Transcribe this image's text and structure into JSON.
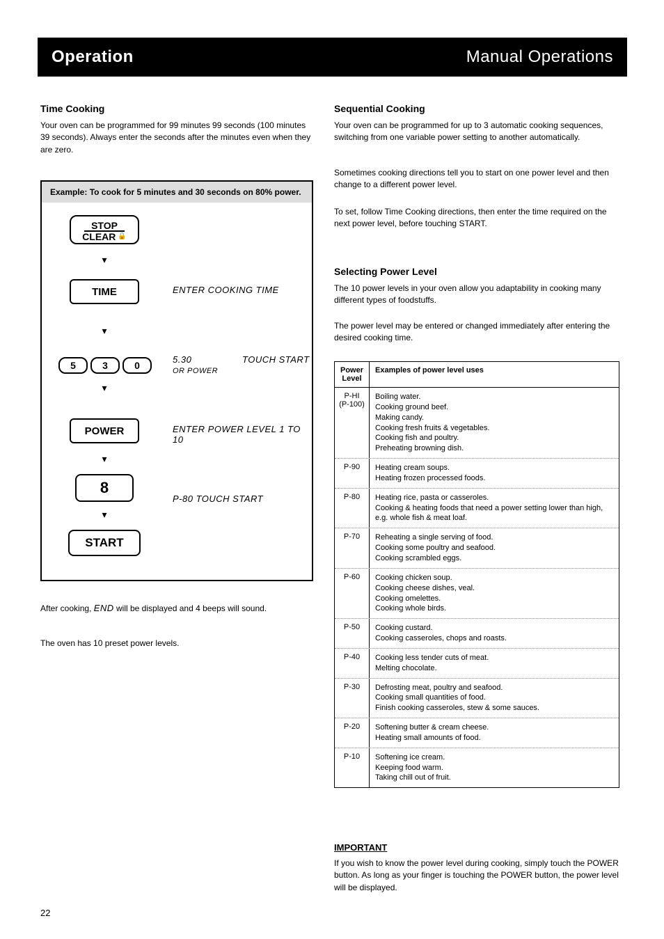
{
  "header": {
    "left": "Operation",
    "right": "Manual Operations"
  },
  "section": {
    "title": "Time Cooking",
    "intro": "Your oven can be programmed for 99 minutes 99 seconds (100 minutes 39 seconds). Always enter the seconds after the minutes even when they are zero."
  },
  "example": {
    "header": "Example: To cook for 5 minutes and 30 seconds on 80% power.",
    "buttons": {
      "stop": "STOP",
      "clear": "CLEAR",
      "time": "TIME",
      "d5": "5",
      "d3": "3",
      "d0": "0",
      "power": "POWER",
      "eight": "8",
      "start": "START"
    },
    "displays": {
      "enter_time": "ENTER COOKING TIME",
      "touch_start": "TOUCH START",
      "or_power": "OR POWER",
      "five30": "5.30",
      "enter_power": "ENTER POWER LEVEL 1 TO 10",
      "p80": "P-80 TOUCH START"
    }
  },
  "after": {
    "p1_a": "After cooking, ",
    "p1_b": "END",
    "p1_c": " will be displayed and 4 beeps will sound.",
    "p2": "The oven has 10 preset power levels."
  },
  "right": {
    "sequential": {
      "title": "Sequential Cooking",
      "body_a": "Your oven can be programmed for up to 3 automatic cooking sequences, switching from one variable power setting to another automatically.",
      "body_b": "Sometimes cooking directions tell you to start on one power level and then change to a different power level.",
      "body_c": "To set, follow Time Cooking directions, then enter the time required on the next power level, before touching START."
    },
    "selecting": {
      "title": "Selecting Power Level",
      "body_a": "The 10 power levels in your oven allow you adaptability in cooking many different types of foodstuffs.",
      "body_b": "The power level may be entered or changed immediately after entering the desired cooking time."
    },
    "table_header": {
      "a": "Power\nLevel",
      "b": "Examples of power level uses"
    },
    "table": [
      {
        "lvl": "P-HI\n(P-100)",
        "use": "Boiling water.\nCooking ground beef.\nMaking candy.\nCooking fresh fruits & vegetables.\nCooking fish and poultry.\nPreheating browning dish."
      },
      {
        "lvl": "P-90",
        "use": "Heating cream soups.\nHeating frozen processed foods."
      },
      {
        "lvl": "P-80",
        "use": "Heating rice, pasta or casseroles.\nCooking & heating foods that need a power setting lower than high, e.g. whole fish & meat loaf."
      },
      {
        "lvl": "P-70",
        "use": "Reheating a single serving of food.\nCooking some poultry and seafood.\nCooking scrambled eggs."
      },
      {
        "lvl": "P-60",
        "use": "Cooking chicken soup.\nCooking cheese dishes, veal.\nCooking omelettes.\nCooking whole birds."
      },
      {
        "lvl": "P-50",
        "use": "Cooking custard.\nCooking casseroles, chops and roasts."
      },
      {
        "lvl": "P-40",
        "use": "Cooking less tender cuts of meat.\nMelting chocolate."
      },
      {
        "lvl": "P-30",
        "use": "Defrosting meat, poultry and seafood.\nCooking small quantities of food.\nFinish cooking casseroles, stew & some sauces."
      },
      {
        "lvl": "P-20",
        "use": "Softening butter & cream cheese.\nHeating small amounts of food."
      },
      {
        "lvl": "P-10",
        "use": "Softening ice cream.\nKeeping food warm.\nTaking chill out of fruit."
      }
    ]
  },
  "warning": {
    "title": "IMPORTANT",
    "body": "If you wish to know the power level during cooking, simply touch the POWER button. As long as your finger is touching the POWER button, the power level will be displayed."
  },
  "page": "22"
}
